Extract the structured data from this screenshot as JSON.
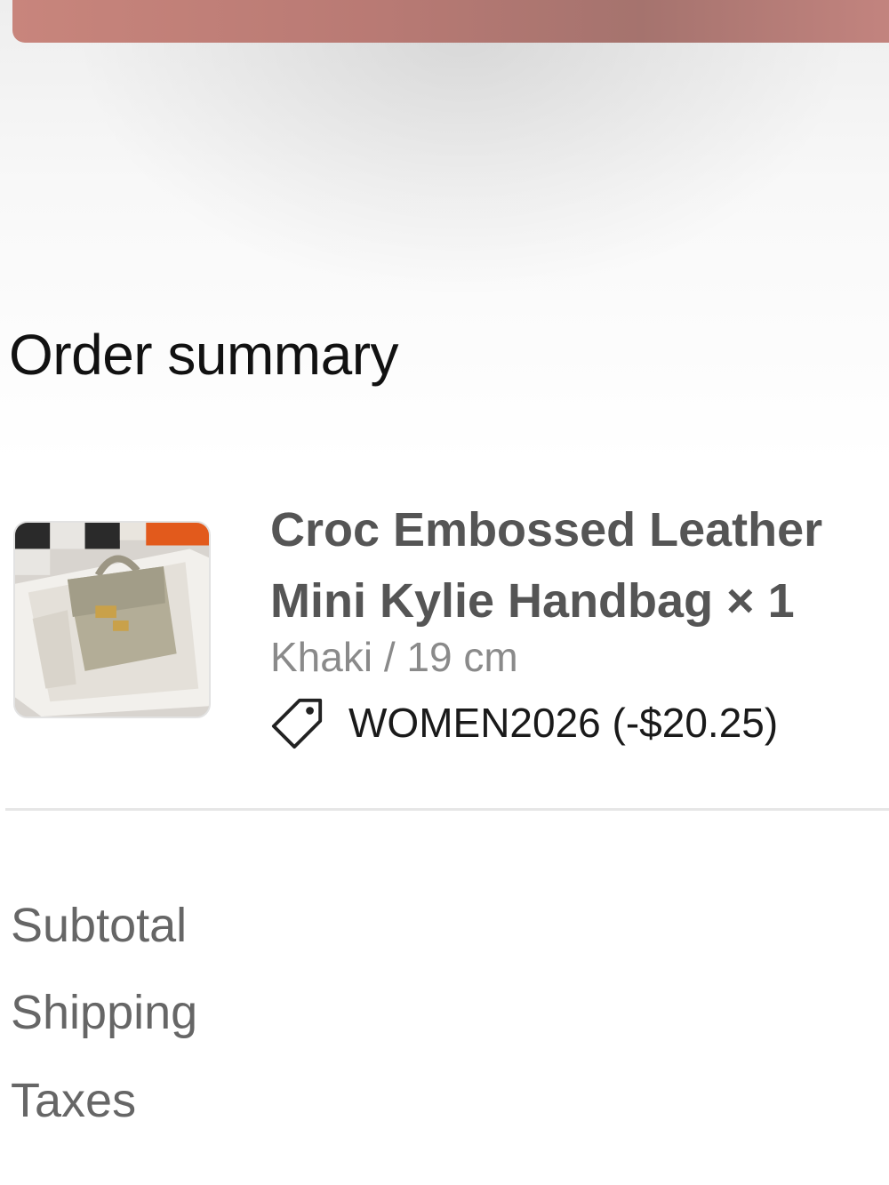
{
  "order_summary": {
    "title": "Order summary",
    "item": {
      "name": "Croc Embossed Leather Mini Kylie Handbag × 1",
      "variant": "Khaki / 19 cm",
      "thumbnail_icon": "handbag-image",
      "discount": {
        "icon": "tag-icon",
        "code_text": "WOMEN2026 (-$20.25)"
      }
    },
    "lines": [
      {
        "label": "Subtotal"
      },
      {
        "label": "Shipping"
      },
      {
        "label": "Taxes"
      }
    ]
  },
  "colors": {
    "top_button": "#b97a74",
    "title_text": "#111111",
    "product_text": "#555555",
    "muted_text": "#8a8a8a",
    "divider": "#e6e6e6"
  }
}
